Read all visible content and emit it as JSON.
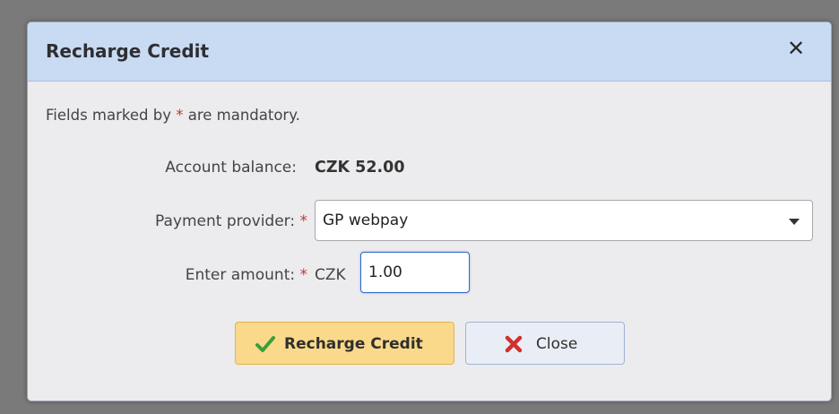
{
  "dialog": {
    "title": "Recharge Credit",
    "close_symbol": "✕",
    "mandatory_note_prefix": "Fields marked by ",
    "mandatory_star": "*",
    "mandatory_note_suffix": " are mandatory."
  },
  "form": {
    "balance_label": "Account balance:",
    "balance_value": "CZK 52.00",
    "provider_label": "Payment provider:",
    "provider_value": "GP webpay",
    "amount_label": "Enter amount:",
    "amount_currency": "CZK",
    "amount_value": "1.00",
    "required_star": "*"
  },
  "buttons": {
    "recharge_label": "Recharge Credit",
    "close_label": "Close"
  },
  "icons": {
    "close": "close-icon",
    "check": "checkmark-icon",
    "cross": "cross-icon",
    "caret": "chevron-down-icon"
  },
  "colors": {
    "header_bg": "#c9dbf3",
    "primary_button": "#fbd98a",
    "required_star": "#c0392b",
    "check_green": "#3aa03a",
    "cross_red": "#d0312d"
  }
}
